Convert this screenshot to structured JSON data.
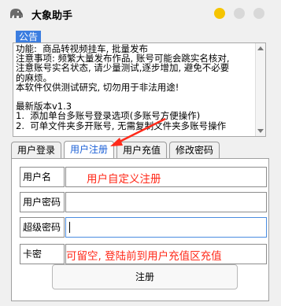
{
  "window": {
    "title": "大象助手",
    "logo_icon": "elephant-icon"
  },
  "notice": {
    "label": "公告",
    "lines": [
      "功能:  商品转视频挂车, 批量发布",
      "注意事项: 频繁大量发布作品, 账号可能会跳实名核对,",
      "注意账号实名状态, 请少量测试,逐步增加, 避免不必要",
      "的麻烦。",
      "本软件仅供测试研究, 切勿用于非法用途!",
      "",
      "最新版本v1.3",
      "1.  添加单台多账号登录选项(多账号方便操作)",
      "2.  可单文件夹多开账号, 无需复制文件夹多账号操作"
    ]
  },
  "tabs": [
    {
      "label": "用户登录",
      "active": false
    },
    {
      "label": "用户注册",
      "active": true
    },
    {
      "label": "用户充值",
      "active": false
    },
    {
      "label": "修改密码",
      "active": false
    }
  ],
  "form": {
    "username_label": "用户名",
    "username_hint": "用户自定义注册",
    "password_label": "用户密码",
    "super_password_label": "超级密码",
    "card_label": "卡密",
    "card_hint": "可留空, 登陆前到用户充值区充值",
    "submit_label": "注册"
  },
  "colors": {
    "accent": "#3b7de0",
    "annotation": "#ff2a1a",
    "active_tab_text": "#1a5fd6"
  }
}
